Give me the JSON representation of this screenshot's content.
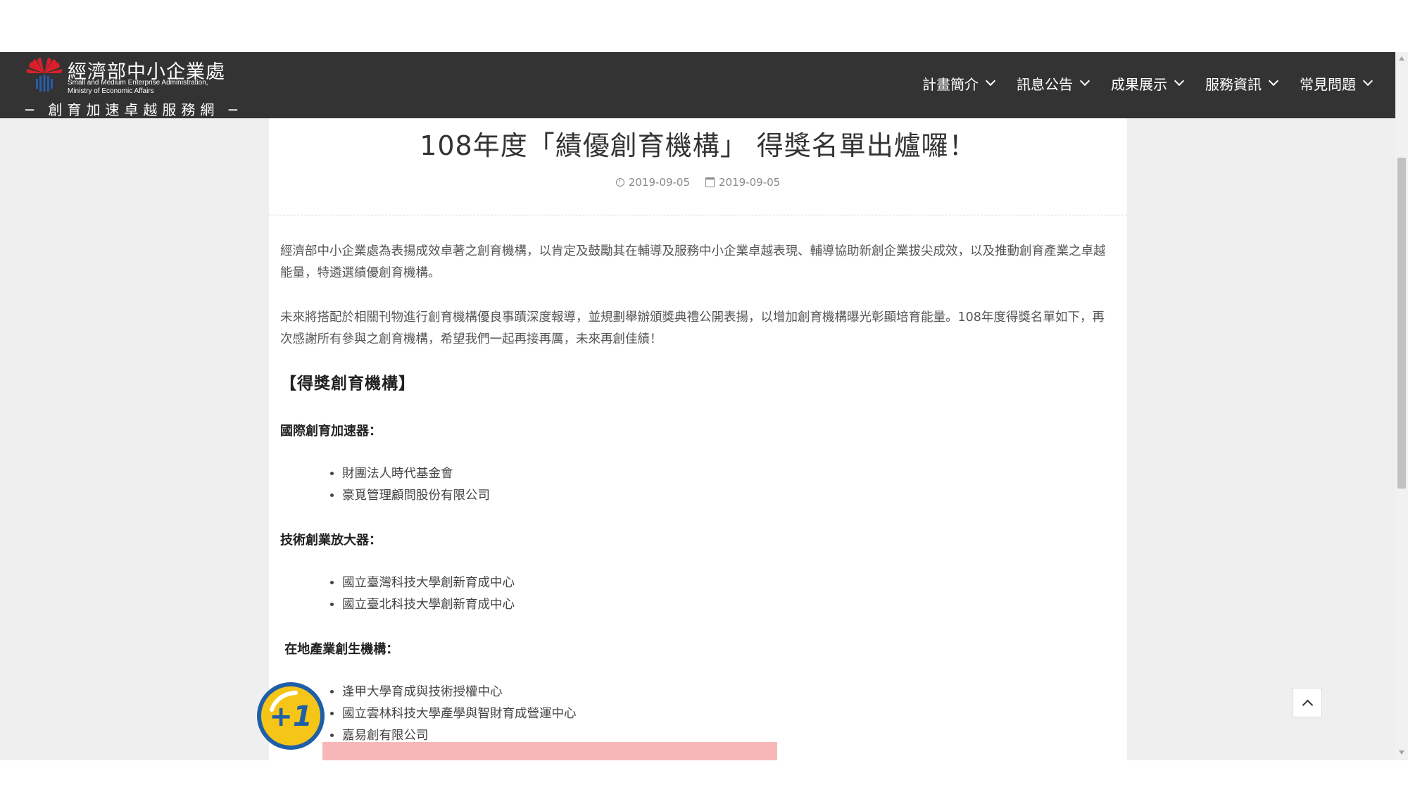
{
  "header": {
    "org_name": "經濟部中小企業處",
    "org_en_line1": "Small and Medium Enterprise Administration,",
    "org_en_line2": "Ministry of Economic Affairs",
    "tagline": "─ 創育加速卓越服務網 ─",
    "menu": [
      {
        "label": "計畫簡介"
      },
      {
        "label": "訊息公告"
      },
      {
        "label": "成果展示"
      },
      {
        "label": "服務資訊"
      },
      {
        "label": "常見問題"
      }
    ]
  },
  "article": {
    "title": "108年度「績優創育機構」 得獎名單出爐囉！",
    "published": "2019-09-05",
    "updated": "2019-09-05",
    "para1": "經濟部中小企業處為表揚成效卓著之創育機構，以肯定及鼓勵其在輔導及服務中小企業卓越表現、輔導協助新創企業拔尖成效，以及推動創育產業之卓越能量，特遴選績優創育機構。",
    "para2": "未來將搭配於相關刊物進行創育機構優良事蹟深度報導，並規劃舉辦頒獎典禮公開表揚，以增加創育機構曝光彰顯培育能量。108年度得獎名單如下，再次感謝所有參與之創育機構，希望我們一起再接再厲，未來再創佳績！",
    "section_title": "【得獎創育機構】",
    "categories": [
      {
        "name": "國際創育加速器：",
        "items": [
          "財團法人時代基金會",
          "豪覓管理顧問股份有限公司"
        ]
      },
      {
        "name": "技術創業放大器：",
        "items": [
          "國立臺灣科技大學創新育成中心",
          "國立臺北科技大學創新育成中心"
        ]
      },
      {
        "name": " 在地產業創生機構：",
        "items": [
          "逢甲大學育成與技術授權中心",
          "國立雲林科技大學產學與智財育成營運中心",
          "嘉易創有限公司"
        ]
      }
    ]
  },
  "colors": {
    "navbar": "#333333",
    "highlight": "#f8b7b7",
    "badge_yellow": "#f5c518",
    "badge_blue": "#1f5fa8"
  },
  "icons": {
    "logo": "moea-flower-logo",
    "published": "clock-icon",
    "updated": "calendar-icon",
    "menu_chevron": "chevron-down-icon",
    "back_to_top": "chevron-up-icon",
    "overlay_badge": "plus-one-badge"
  }
}
